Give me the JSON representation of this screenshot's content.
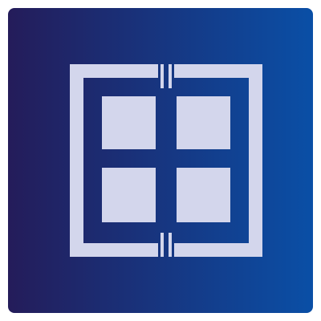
{
  "icon": {
    "name": "window-grid-icon",
    "colors": {
      "gradient_start": "#241c5a",
      "gradient_end": "#0a4fa6",
      "glyph": "#d3d6ec"
    }
  }
}
